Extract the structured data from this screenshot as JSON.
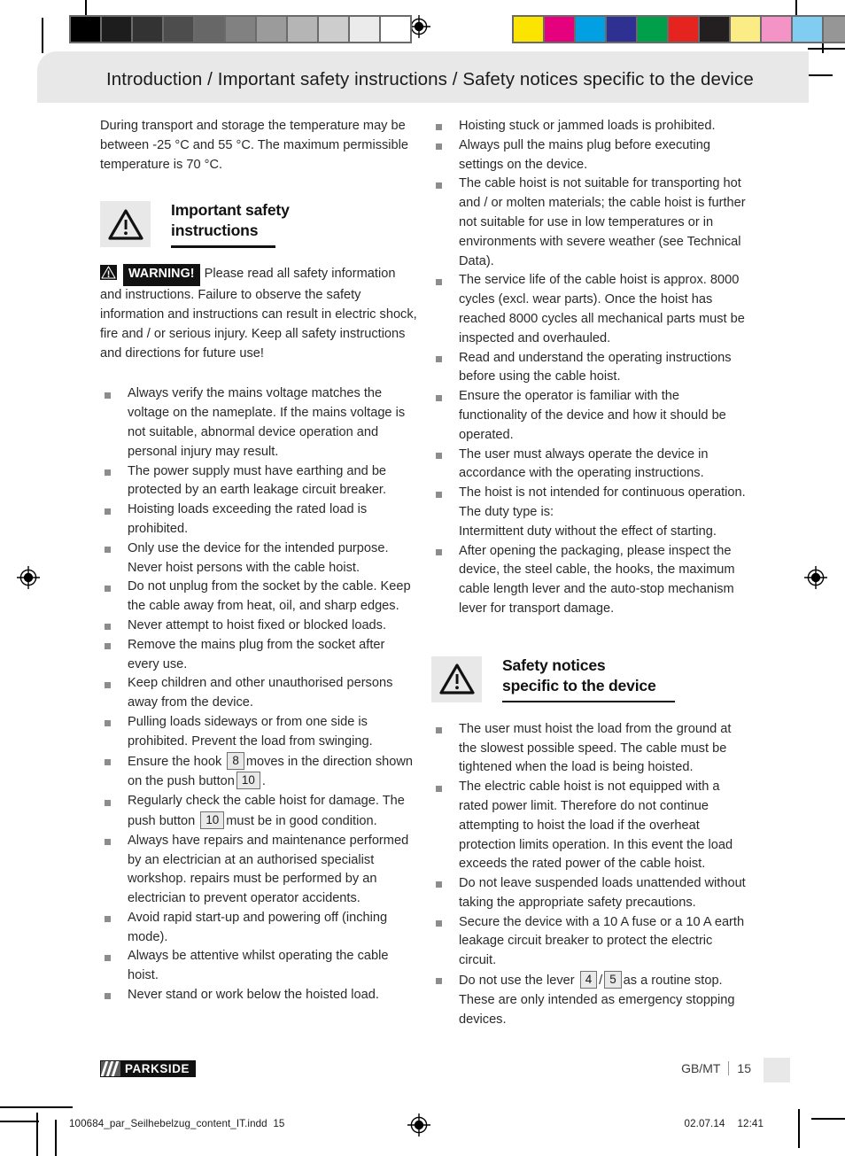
{
  "header": {
    "title": "Introduction / Important safety instructions / Safety notices specific to the device"
  },
  "calibration": {
    "gray_bar": [
      "#000000",
      "#1d1d1d",
      "#333333",
      "#4d4d4d",
      "#676767",
      "#818181",
      "#9b9b9b",
      "#b5b5b5",
      "#cdcdcd",
      "#ebebeb",
      "#ffffff"
    ],
    "color_bar": [
      "#fbe500",
      "#e5007e",
      "#00a0e3",
      "#2e3191",
      "#00a04b",
      "#e52420",
      "#231f20",
      "#fbec85",
      "#f493c6",
      "#80cdf1",
      "#969696"
    ]
  },
  "left_column": {
    "intro_paragraph": "During transport and storage the temperature may be between -25 °C and 55 °C. The maximum permissible temperature is 70 °C.",
    "section_heading": {
      "line1": "Important safety",
      "line2": "instructions",
      "icon": "warning-triangle-icon"
    },
    "warning": {
      "badge": "WARNING!",
      "text": "Please read all safety information and instructions. Failure to observe the safety information and instructions can result in electric shock, fire and / or serious injury. Keep all safety instructions and directions for future use!"
    },
    "bullets": [
      "Always verify the mains voltage matches the voltage on the nameplate. If the mains voltage is not suitable, abnormal device operation and personal injury may result.",
      "The power supply must have earthing and be protected by an earth leakage circuit breaker.",
      "Hoisting loads exceeding the rated load is prohibited.",
      "Only use the device for the intended purpose. Never hoist persons with the cable hoist.",
      "Do not unplug from the socket by the cable. Keep the cable away from heat, oil, and sharp edges.",
      "Never attempt to hoist fixed or blocked loads.",
      "Remove the mains plug from the socket after every use.",
      "Keep children and other unauthorised persons away from the device.",
      "Pulling loads sideways or from one side is prohibited. Prevent the load from swinging."
    ],
    "bullet_hook": {
      "part1": "Ensure the hook",
      "ref1": "8",
      "part2": "moves in the direction shown on the push button",
      "ref2": "10",
      "part3": "."
    },
    "bullet_check": {
      "part1": "Regularly check the cable hoist for damage. The push button",
      "ref1": "10",
      "part2": "must be in good condition."
    },
    "bullets_tail": [
      "Always have repairs and maintenance performed by an electrician at an authorised specialist workshop. repairs must be performed by an electrician to prevent operator accidents.",
      "Avoid rapid start-up and powering off (inching mode).",
      "Always be attentive whilst operating the cable hoist.",
      "Never stand or work below the hoisted load."
    ]
  },
  "right_column": {
    "bullets_top": [
      "Hoisting stuck or jammed loads is prohibited.",
      "Always pull the mains plug before executing settings on the device.",
      "The cable hoist is not suitable for transporting hot and / or molten materials; the cable hoist is further not suitable for use in low temperatures or in environments with severe weather (see Technical Data).",
      "The service life of the cable hoist is approx. 8000 cycles (excl. wear parts). Once the hoist has reached 8000 cycles all mechanical parts must be inspected and overhauled.",
      "Read and understand the operating instructions before using the cable hoist.",
      "Ensure the operator is familiar with the functionality of the device and how it should be operated.",
      "The user must always operate the device in accordance with the operating instructions.",
      "The hoist is not intended for continuous operation. The duty type is:\nIntermittent duty without the effect of starting.",
      "After opening the packaging, please inspect the device, the steel cable, the hooks, the maximum cable length lever and the auto-stop mechanism lever for transport damage."
    ],
    "section_heading": {
      "line1": "Safety notices",
      "line2": "specific to the device",
      "icon": "warning-triangle-icon"
    },
    "bullets_bottom": [
      "The user must hoist the load from the ground at the slowest possible speed. The cable must be tightened when the load is being hoisted.",
      "The electric cable hoist is not equipped with a rated power limit. Therefore do not continue attempting to hoist the load if the overheat protection limits operation. In this event the load exceeds the rated power of the cable hoist.",
      "Do not leave suspended loads unattended without taking the appropriate safety precautions.",
      "Secure the device with a 10 A fuse or a 10 A earth leakage circuit breaker to protect the electric circuit."
    ],
    "bullet_lever": {
      "part1": "Do not use the lever",
      "ref1": "4",
      "sep": "/",
      "ref2": "5",
      "part2": "as a routine stop. These are only intended as emergency stopping devices."
    }
  },
  "footer": {
    "logo_text": "PARKSIDE",
    "language": "GB/MT",
    "page_number": "15"
  },
  "print_info": {
    "filename": "100684_par_Seilhebelzug_content_IT.indd",
    "page": "15",
    "date": "02.07.14",
    "time": "12:41"
  }
}
